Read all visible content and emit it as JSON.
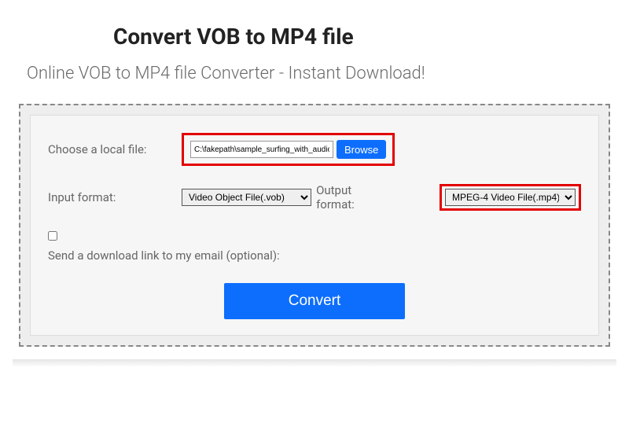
{
  "header": {
    "title": "Convert VOB to MP4 file",
    "subtitle": "Online VOB to MP4 file Converter - Instant Download!"
  },
  "form": {
    "choose_file_label": "Choose a local file:",
    "file_path_value": "C:\\fakepath\\sample_surfing_with_audio.vo",
    "browse_label": "Browse",
    "input_format_label": "Input format:",
    "input_format_selected": "Video Object File(.vob)",
    "output_format_label": "Output format:",
    "output_format_selected": "MPEG-4 Video File(.mp4)",
    "email_label": "Send a download link to my email (optional):",
    "convert_label": "Convert"
  }
}
